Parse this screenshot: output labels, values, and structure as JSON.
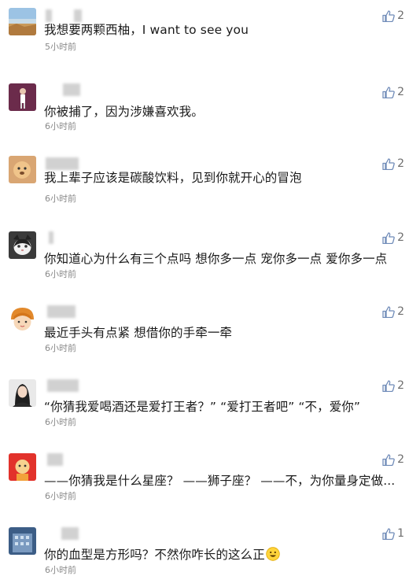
{
  "comments": [
    {
      "text": "我想要两颗西柚，I want to see you",
      "time": "5小时前",
      "likes": "2",
      "avatar": "landscape-avatar"
    },
    {
      "text": "你被捕了，因为涉嫌喜欢我。",
      "time": "6小时前",
      "likes": "2",
      "avatar": "figure-avatar"
    },
    {
      "text": "我上辈子应该是碳酸饮料，见到你就开心的冒泡",
      "time": "6小时前",
      "likes": "2",
      "avatar": "dog-avatar"
    },
    {
      "text": "你知道心为什么有三个点吗 想你多一点 宠你多一点 爱你多一点",
      "time": "6小时前",
      "likes": "2",
      "avatar": "cat-avatar"
    },
    {
      "text": "最近手头有点紧 想借你的手牵一牵",
      "time": "6小时前",
      "likes": "2",
      "avatar": "cartoon-girl-avatar"
    },
    {
      "text": "“你猜我爱喝酒还是爱打王者？” “爱打王者吧” “不，爱你”",
      "time": "6小时前",
      "likes": "2",
      "avatar": "woman-portrait-avatar"
    },
    {
      "text": "——你猜我是什么星座？ ——狮子座？ ——不，为你量身定做...",
      "time": "6小时前",
      "likes": "2",
      "avatar": "doll-avatar"
    },
    {
      "text": "你的血型是方形吗？不然你咋长的这么正",
      "time": "6小时前",
      "likes": "1",
      "avatar": "building-avatar"
    }
  ],
  "icons": {
    "like": "thumbs-up-icon",
    "emoji": "grinning-face-emoji-icon"
  },
  "colors": {
    "like_icon": "#6f8bb8",
    "text": "#1a1a1a",
    "time": "#8a8a8a"
  }
}
